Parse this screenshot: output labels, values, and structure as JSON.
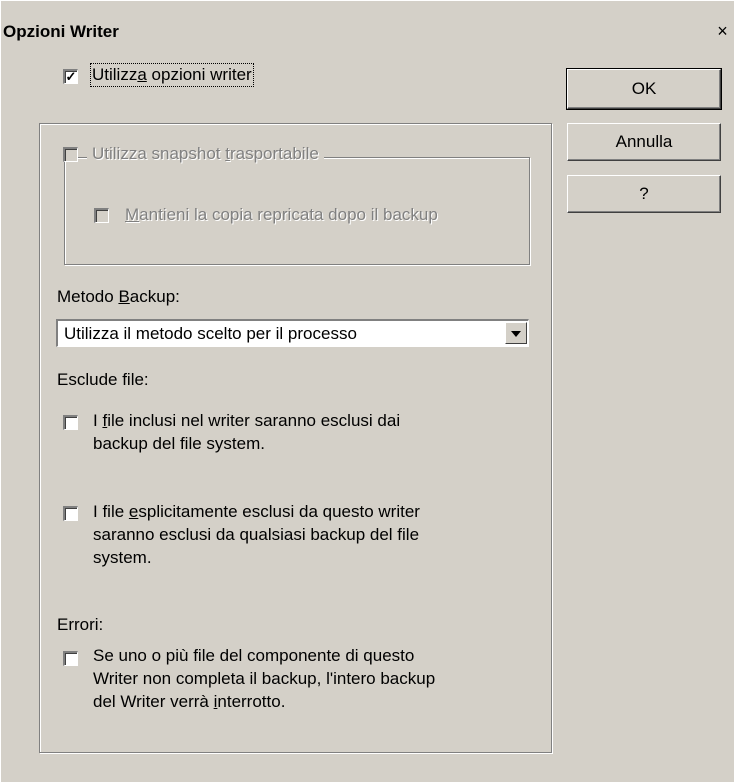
{
  "dialog": {
    "title": "Opzioni Writer",
    "close_glyph": "×"
  },
  "use_writer_options": {
    "label_pre": "Utilizz",
    "label_key": "a",
    "label_post": " opzioni writer",
    "checked": true,
    "check_glyph": "✓"
  },
  "buttons": {
    "ok": "OK",
    "cancel": "Annulla",
    "help": "?"
  },
  "transportable": {
    "label_pre": "Utilizza snapshot ",
    "label_key": "t",
    "label_post": "rasportabile",
    "enabled": false
  },
  "keep_copy": {
    "label_key": "M",
    "label_post": "antieni la copia repricata dopo il backup",
    "enabled": false
  },
  "backup_method": {
    "label_pre": "Metodo ",
    "label_key": "B",
    "label_post": "ackup:",
    "selected": "Utilizza il metodo scelto per il processo"
  },
  "exclude_files": {
    "heading": "Esclude file:",
    "option1": {
      "line1_pre": "I ",
      "line1_key": "f",
      "line1_post": "ile inclusi nel writer saranno esclusi dai",
      "line2": "backup del file system."
    },
    "option2": {
      "line1_pre": "I file ",
      "line1_key": "e",
      "line1_post": "splicitamente esclusi da questo writer",
      "line2": "saranno esclusi da qualsiasi backup del file",
      "line3": "system."
    }
  },
  "errors": {
    "heading": "Errori:",
    "line1": "Se uno o più file del componente di questo",
    "line2": "Writer non completa il backup, l'intero backup",
    "line3_pre": "del Writer verrà ",
    "line3_key": "i",
    "line3_post": "nterrotto."
  }
}
